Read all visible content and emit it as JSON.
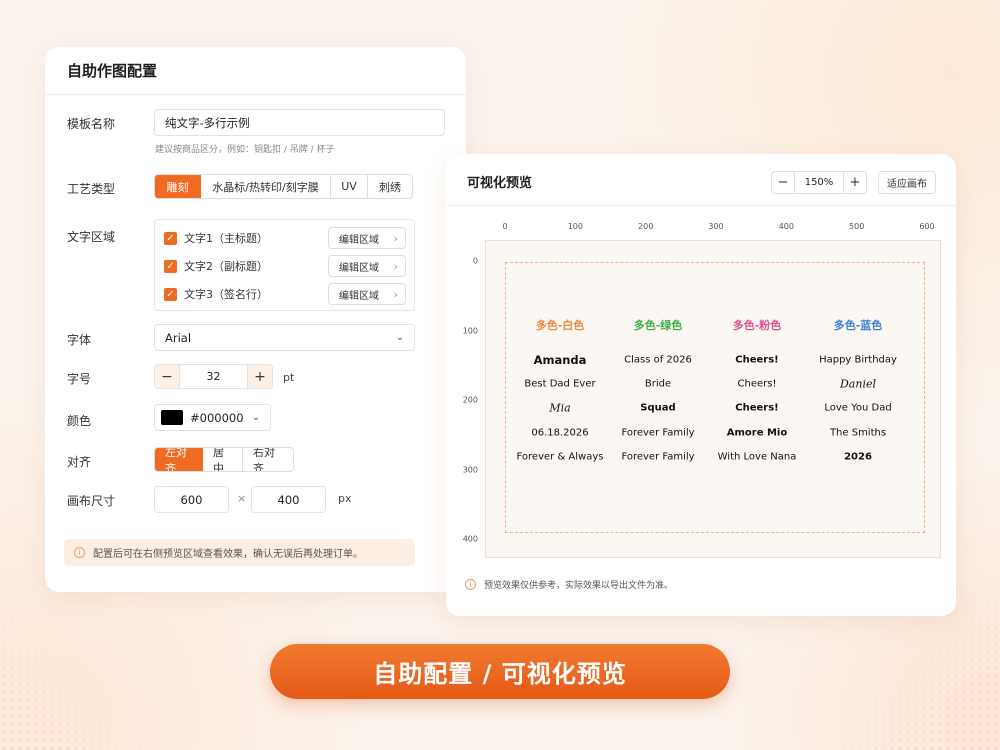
{
  "config_panel": {
    "title": "自助作图配置",
    "template_name": {
      "label": "模板名称",
      "value": "纯文字-多行示例",
      "hint": "建议按商品区分，例如：钥匙扣 / 吊牌 / 杯子"
    },
    "process_type": {
      "label": "工艺类型",
      "options": [
        "雕刻",
        "水晶标/热转印/刻字膜",
        "UV",
        "刺绣"
      ],
      "selected": "雕刻"
    },
    "text_areas": {
      "label": "文字区域",
      "items": [
        {
          "label": "文字1（主标题）",
          "checked": true,
          "edit": "编辑区域"
        },
        {
          "label": "文字2（副标题）",
          "checked": true,
          "edit": "编辑区域"
        },
        {
          "label": "文字3（签名行）",
          "checked": true,
          "edit": "编辑区域"
        }
      ]
    },
    "font": {
      "label": "字体",
      "value": "Arial"
    },
    "font_size": {
      "label": "字号",
      "value": "32",
      "unit": "pt",
      "minus": "−",
      "plus": "+"
    },
    "color": {
      "label": "颜色",
      "value": "#000000",
      "swatch": "#000000"
    },
    "align": {
      "label": "对齐",
      "options": [
        "左对齐",
        "居中",
        "右对齐"
      ],
      "selected": "左对齐"
    },
    "canvas_size": {
      "label": "画布尺寸",
      "width": "600",
      "height": "400",
      "separator": "×",
      "unit": "px"
    },
    "notice": "配置后可在右侧预览区域查看效果，确认无误后再处理订单。"
  },
  "preview_panel": {
    "title": "可视化预览",
    "zoom": {
      "minus": "−",
      "value": "150%",
      "plus": "+"
    },
    "fit_button": "适应画布",
    "ruler_x": [
      "0",
      "100",
      "200",
      "300",
      "400",
      "500",
      "600"
    ],
    "ruler_y": [
      "0",
      "100",
      "200",
      "300",
      "400"
    ],
    "columns": [
      {
        "title": "多色-白色",
        "color": "#ef8a3c",
        "lines": [
          "Amanda",
          "Best Dad Ever",
          "Mia",
          "06.18.2026",
          "Forever & Always"
        ]
      },
      {
        "title": "多色-绿色",
        "color": "#3fae49",
        "lines": [
          "Class of 2026",
          "Bride",
          "Squad",
          "Forever Family",
          "Forever Family"
        ]
      },
      {
        "title": "多色-粉色",
        "color": "#e0508e",
        "lines": [
          "Cheers!",
          "Cheers!",
          "Cheers!",
          "Amore Mio",
          "With Love Nana"
        ]
      },
      {
        "title": "多色-蓝色",
        "color": "#3b82d6",
        "lines": [
          "Happy Birthday",
          "Daniel",
          "Love You Dad",
          "The Smiths",
          "2026"
        ]
      }
    ],
    "footnote": "预览效果仅供参考，实际效果以导出文件为准。"
  },
  "cta": "自助配置 / 可视化预览",
  "colors": {
    "accent": "#ef6a23",
    "background": "#fbf3ec"
  }
}
